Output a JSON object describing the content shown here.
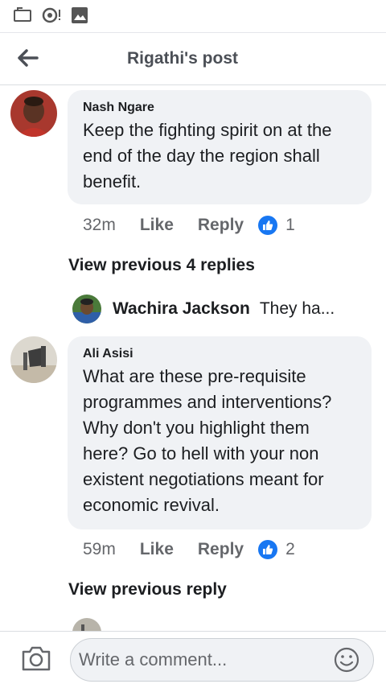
{
  "header": {
    "title": "Rigathi's post",
    "back_icon": "arrow-left-icon"
  },
  "comments": [
    {
      "author": "Nash Ngare",
      "text": "Keep the fighting spirit on at the end of the day the region shall benefit.",
      "time": "32m",
      "like_label": "Like",
      "reply_label": "Reply",
      "reaction_count": "1"
    },
    {
      "author": "Ali Asisi",
      "text": "What are these pre-requisite programmes and interventions? Why don't you highlight them here? Go to hell with your non existent negotiations meant for economic revival.",
      "time": "59m",
      "like_label": "Like",
      "reply_label": "Reply",
      "reaction_count": "2"
    }
  ],
  "view_previous_1": "View previous 4 replies",
  "reply_preview": {
    "author": "Wachira Jackson",
    "snippet": "They ha..."
  },
  "view_previous_2": "View previous reply",
  "composer": {
    "placeholder": "Write a comment..."
  },
  "colors": {
    "like_blue": "#1877f2",
    "bubble_bg": "#f0f2f5",
    "meta_gray": "#65676b"
  }
}
